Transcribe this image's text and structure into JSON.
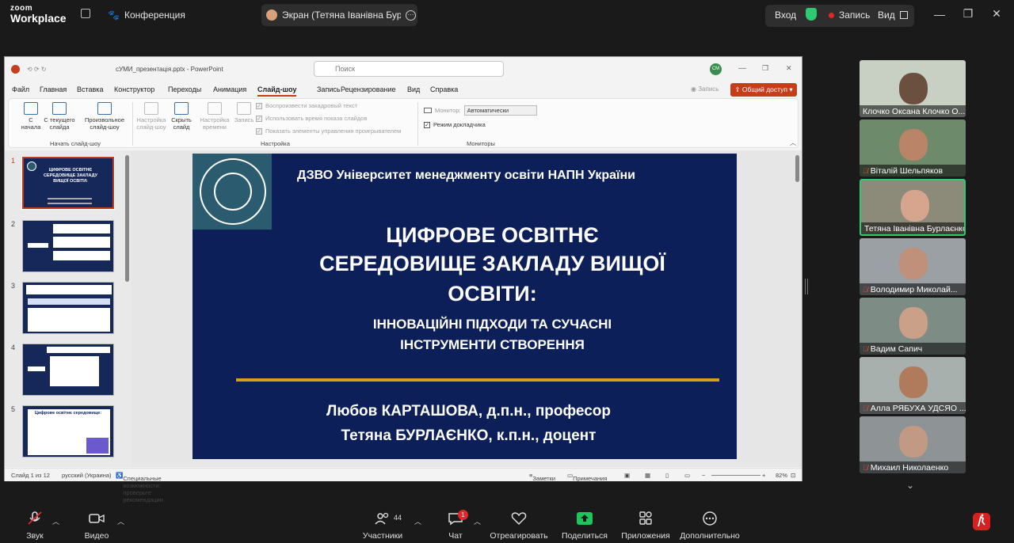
{
  "zoom": {
    "logo_line1": "zoom",
    "logo_line2": "Workplace",
    "meeting_label": "Конференция",
    "share_label": "Экран (Тетяна Іванівна Бурлаєн",
    "signin_label": "Вход",
    "record_label": "Запись",
    "view_label": "Вид",
    "colors": {
      "accent_green": "#2ecc71",
      "record_red": "#e02828"
    }
  },
  "ppt": {
    "filename": "сУМИ_презентація.pptx",
    "app_name": "PowerPoint",
    "search_placeholder": "Поиск",
    "user_initials": "CM",
    "menu": [
      "Файл",
      "Главная",
      "Вставка",
      "Конструктор",
      "Переходы",
      "Анимация",
      "Слайд-шоу",
      "Запись",
      "Рецензирование",
      "Вид",
      "Справка"
    ],
    "record_btn": "Запись",
    "share_btn": "Общий доступ",
    "ribbon": {
      "start_from_beginning": "С\nначала",
      "from_current": "С текущего\nслайда",
      "custom_show": "Произвольное\nслайд-шоу",
      "setup_show": "Настройка\nслайд-шоу",
      "hide_slide": "Скрыть\nслайд",
      "rehearse": "Настройка\nвремени",
      "record": "Запись",
      "group_start": "Начать слайд-шоу",
      "group_setup": "Настройка",
      "group_monitors": "Мониторы",
      "chk_narration": "Воспроизвести закадровый текст",
      "chk_timings": "Использовать время показа слайдов",
      "chk_controls": "Показать элементы управления проигрывателем",
      "monitor_label": "Монитор:",
      "monitor_value": "Автоматически",
      "presenter_view": "Режим докладчика"
    },
    "slide_numbers": [
      "1",
      "2",
      "3",
      "4",
      "5"
    ],
    "thumb1_title": "ЦИФРОВЕ ОСВІТНЄ СЕРЕДОВИЩЕ ЗАКЛАДУ ВИЩОЇ ОСВІТИ:",
    "thumb5_title": "Цифрове освітнє середовище:",
    "slide": {
      "university": "ДЗВО Університет менеджменту освіти НАПН України",
      "title_line1": "ЦИФРОВЕ ОСВІТНЄ",
      "title_line2": "СЕРЕДОВИЩЕ ЗАКЛАДУ ВИЩОЇ",
      "title_line3": "ОСВІТИ:",
      "subtitle_line1": "ІННОВАЦІЙНІ ПІДХОДИ  ТА СУЧАСНІ",
      "subtitle_line2": "ІНСТРУМЕНТИ СТВОРЕННЯ",
      "author1": "Любов КАРТАШОВА, д.п.н., професор",
      "author2": "Тетяна БУРЛАЄНКО, к.п.н., доцент"
    },
    "status": {
      "slide_count": "Слайд 1 из 12",
      "language": "русский (Украина)",
      "accessibility": "Специальные возможности: проверьте рекомендации",
      "notes": "Заметки",
      "comments": "Примечания",
      "zoom": "82%"
    }
  },
  "participants": [
    {
      "name": "Клочко Оксана Клочко О...",
      "muted": false
    },
    {
      "name": "Віталій Шельпяков",
      "muted": true
    },
    {
      "name": "Тетяна Іванівна Бурлаєнко",
      "muted": false,
      "active": true
    },
    {
      "name": "Володимир Миколай...",
      "muted": true
    },
    {
      "name": "Вадим Сапич",
      "muted": true
    },
    {
      "name": "Алла РЯБУХА УДСЯО ...",
      "muted": true
    },
    {
      "name": "Михаил Николаенко",
      "muted": true
    }
  ],
  "toolbar": {
    "audio": "Звук",
    "video": "Видео",
    "participants": "Участники",
    "participants_count": "44",
    "chat": "Чат",
    "chat_badge": "1",
    "react": "Отреагировать",
    "share": "Поделиться",
    "apps": "Приложения",
    "more": "Дополнительно"
  }
}
